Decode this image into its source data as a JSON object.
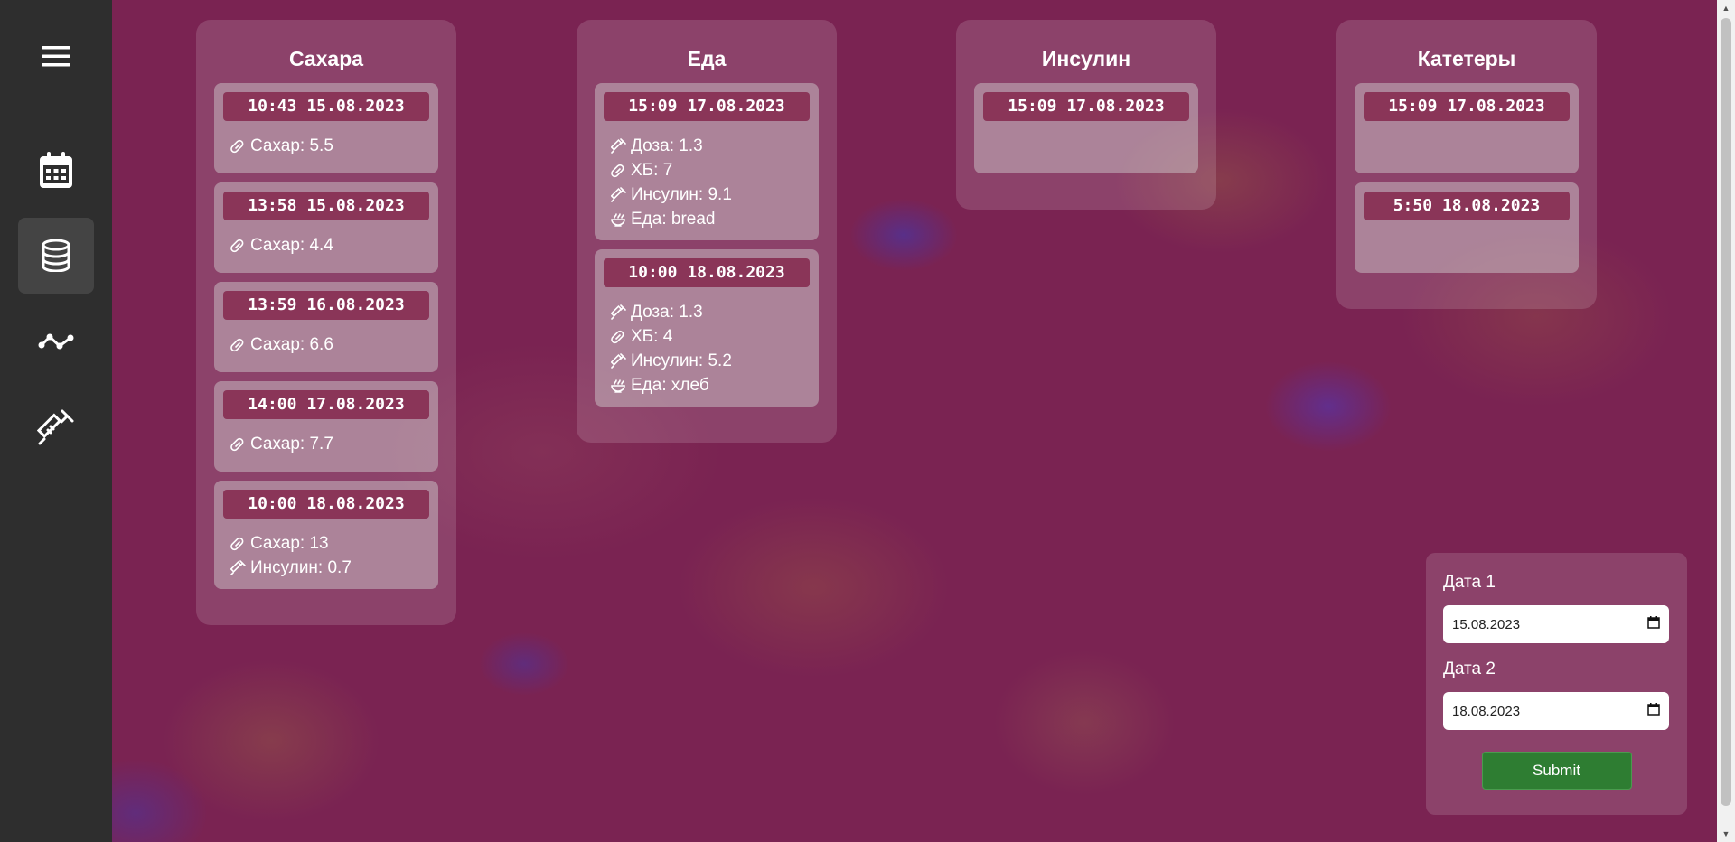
{
  "sidebar": {
    "menu_icon": "hamburger-icon",
    "items": [
      {
        "icon": "calendar-icon",
        "active": false
      },
      {
        "icon": "database-icon",
        "active": true
      },
      {
        "icon": "chart-line-icon",
        "active": false
      },
      {
        "icon": "syringe-icon",
        "active": false
      }
    ]
  },
  "columns": [
    {
      "title": "Сахара",
      "cards": [
        {
          "date": "10:43 15.08.2023",
          "lines": [
            {
              "icon": "sugar-icon",
              "text": "Сахар: 5.5"
            }
          ]
        },
        {
          "date": "13:58 15.08.2023",
          "lines": [
            {
              "icon": "sugar-icon",
              "text": "Сахар: 4.4"
            }
          ]
        },
        {
          "date": "13:59 16.08.2023",
          "lines": [
            {
              "icon": "sugar-icon",
              "text": "Сахар: 6.6"
            }
          ]
        },
        {
          "date": "14:00 17.08.2023",
          "lines": [
            {
              "icon": "sugar-icon",
              "text": "Сахар: 7.7"
            }
          ]
        },
        {
          "date": "10:00 18.08.2023",
          "lines": [
            {
              "icon": "sugar-icon",
              "text": "Сахар: 13"
            },
            {
              "icon": "syringe-icon",
              "text": "Инсулин: 0.7"
            }
          ]
        }
      ]
    },
    {
      "title": "Еда",
      "cards": [
        {
          "date": "15:09 17.08.2023",
          "lines": [
            {
              "icon": "syringe-icon",
              "text": "Доза: 1.3"
            },
            {
              "icon": "sugar-icon",
              "text": "ХБ: 7"
            },
            {
              "icon": "syringe-icon",
              "text": "Инсулин: 9.1"
            },
            {
              "icon": "bowl-icon",
              "text": "Еда: bread"
            }
          ]
        },
        {
          "date": "10:00 18.08.2023",
          "lines": [
            {
              "icon": "syringe-icon",
              "text": "Доза: 1.3"
            },
            {
              "icon": "sugar-icon",
              "text": "ХБ: 4"
            },
            {
              "icon": "syringe-icon",
              "text": "Инсулин: 5.2"
            },
            {
              "icon": "bowl-icon",
              "text": "Еда: хлеб"
            }
          ]
        }
      ]
    },
    {
      "title": "Инсулин",
      "cards": [
        {
          "date": "15:09 17.08.2023",
          "lines": []
        }
      ]
    },
    {
      "title": "Катетеры",
      "cards": [
        {
          "date": "15:09 17.08.2023",
          "lines": []
        },
        {
          "date": "5:50 18.08.2023",
          "lines": []
        }
      ]
    }
  ],
  "date_form": {
    "label1": "Дата 1",
    "value1": "15.08.2023",
    "label2": "Дата 2",
    "value2": "18.08.2023",
    "submit_label": "Submit"
  },
  "colors": {
    "sidebar": "#2e2e2e",
    "date_header": "#8a3558",
    "submit": "#2e7d32"
  }
}
